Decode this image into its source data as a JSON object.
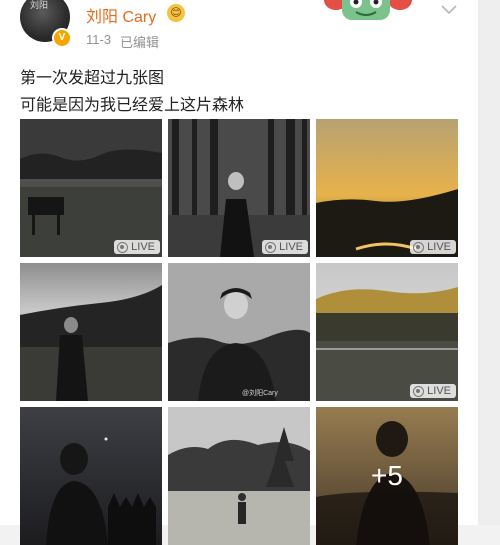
{
  "post": {
    "username": "刘阳 Cary",
    "emoji": "😊",
    "date": "11-3",
    "edited": "已编辑",
    "avatar_text": "刘阳",
    "lines": [
      "第一次发超过九张图",
      "可能是因为我已经爱上这片森林"
    ]
  },
  "photos": {
    "live_label": "LIVE",
    "watermark": "@刘阳Cary",
    "more_count": "+5"
  },
  "icons": {
    "more": "chevron-down-icon",
    "verified": "verified-badge-icon",
    "live": "live-photo-icon"
  },
  "colors": {
    "username": "#e86b1c",
    "meta": "#939393",
    "verified": "#f7a600"
  }
}
